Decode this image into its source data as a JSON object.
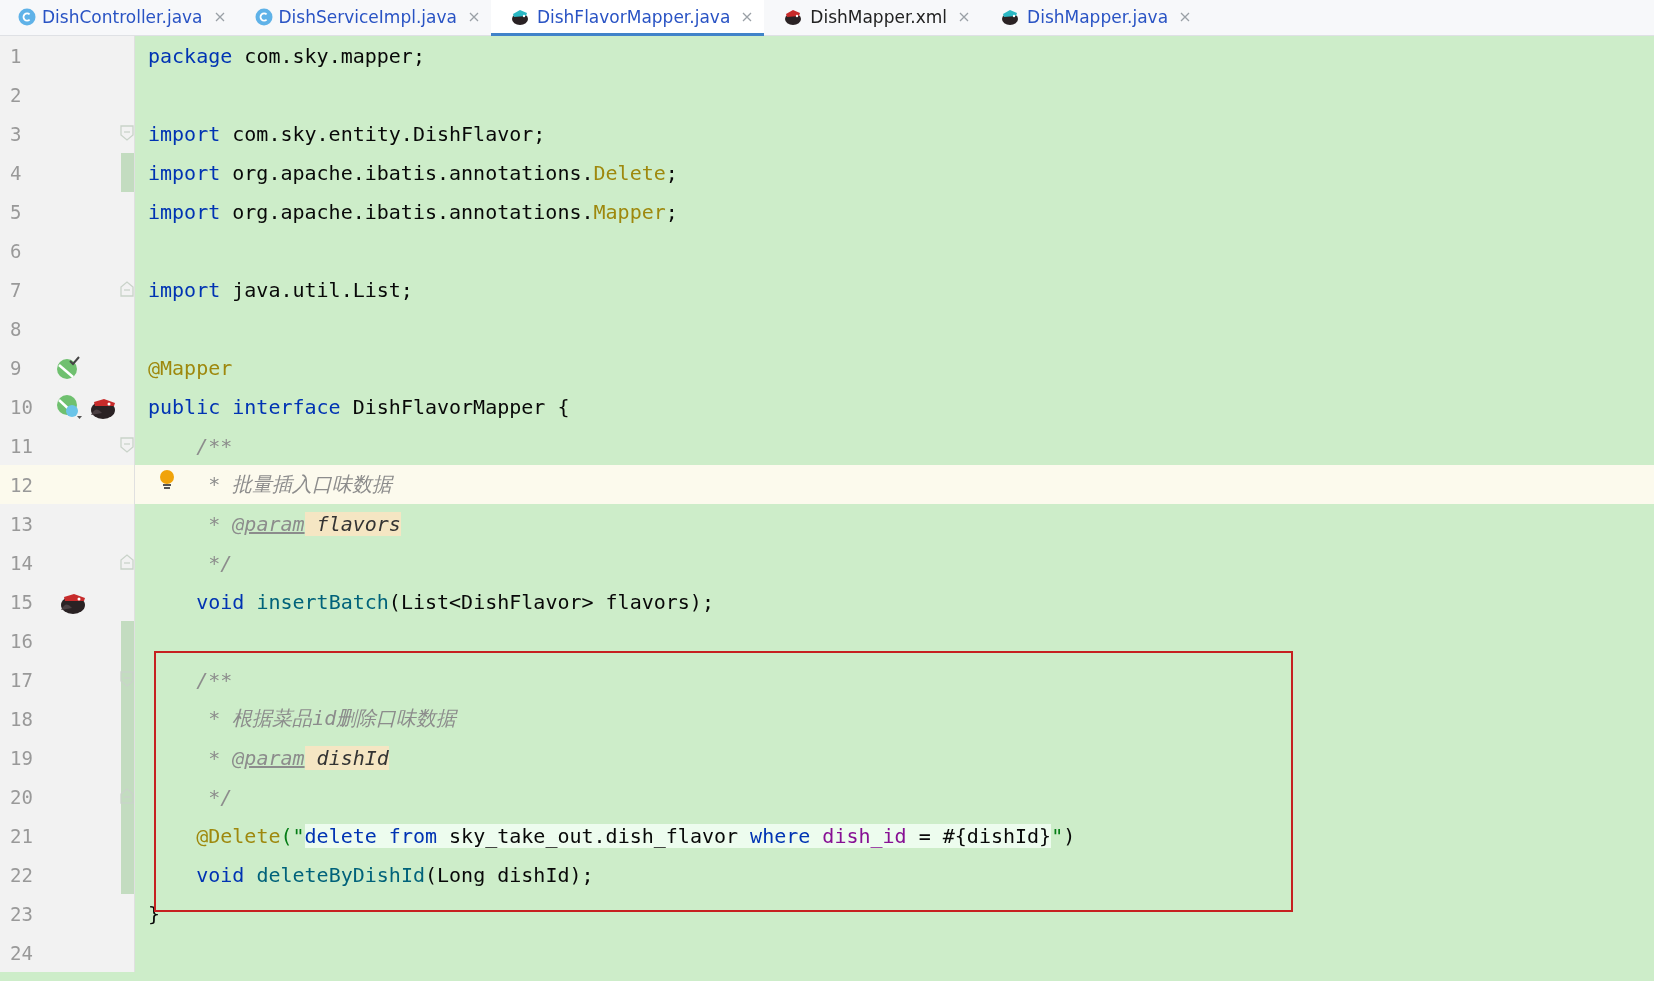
{
  "tabs": [
    {
      "label": "DishController.java",
      "kind": "class",
      "selected": false
    },
    {
      "label": "DishServiceImpl.java",
      "kind": "class",
      "selected": false
    },
    {
      "label": "DishFlavorMapper.java",
      "kind": "mapper",
      "selected": true
    },
    {
      "label": "DishMapper.xml",
      "kind": "xml",
      "selected": false
    },
    {
      "label": "DishMapper.java",
      "kind": "mapper",
      "selected": false
    }
  ],
  "editor": {
    "lines": [
      {
        "number": "1",
        "tokens": [
          {
            "text": "package",
            "kind": "kw"
          },
          {
            "text": " com.sky.mapper;",
            "kind": "plain"
          }
        ]
      },
      {
        "number": "2"
      },
      {
        "number": "3",
        "fold_start": true,
        "tokens": [
          {
            "text": "import",
            "kind": "kw"
          },
          {
            "text": " com.sky.entity.DishFlavor;",
            "kind": "plain"
          }
        ]
      },
      {
        "number": "4",
        "changed": true,
        "tokens": [
          {
            "text": "import",
            "kind": "kw"
          },
          {
            "text": " org.apache.ibatis.annotations.",
            "kind": "plain"
          },
          {
            "text": "Delete",
            "kind": "annotation"
          },
          {
            "text": ";",
            "kind": "plain"
          }
        ]
      },
      {
        "number": "5",
        "tokens": [
          {
            "text": "import",
            "kind": "kw"
          },
          {
            "text": " org.apache.ibatis.annotations.",
            "kind": "plain"
          },
          {
            "text": "Mapper",
            "kind": "annotation"
          },
          {
            "text": ";",
            "kind": "plain"
          }
        ]
      },
      {
        "number": "6"
      },
      {
        "number": "7",
        "fold_end": true,
        "tokens": [
          {
            "text": "import",
            "kind": "kw"
          },
          {
            "text": " java.util.List;",
            "kind": "plain"
          }
        ]
      },
      {
        "number": "8"
      },
      {
        "number": "9",
        "gutter_icons": [
          {
            "kind": "implemented"
          }
        ],
        "tokens": [
          {
            "text": "@Mapper",
            "kind": "annotation"
          }
        ]
      },
      {
        "number": "10",
        "gutter_icons": [
          {
            "kind": "implemented-class"
          },
          {
            "kind": "bird"
          }
        ],
        "tokens": [
          {
            "text": "public",
            "kind": "kw"
          },
          {
            "text": " interface",
            "kind": "kw"
          },
          {
            "text": " DishFlavorMapper {",
            "kind": "plain"
          }
        ]
      },
      {
        "number": "11",
        "fold_start": true,
        "tokens": [
          {
            "text": "    /**",
            "kind": "comment"
          }
        ]
      },
      {
        "number": "12",
        "current": true,
        "bulb": true,
        "tokens": [
          {
            "text": "     * 批量插入口味数据",
            "kind": "comment"
          }
        ]
      },
      {
        "number": "13",
        "tokens": [
          {
            "text": "     * ",
            "kind": "comment"
          },
          {
            "text": "@param",
            "kind": "doctag"
          },
          {
            "text": " flavors",
            "kind": "docparam"
          }
        ]
      },
      {
        "number": "14",
        "fold_end": true,
        "tokens": [
          {
            "text": "     */",
            "kind": "comment"
          }
        ]
      },
      {
        "number": "15",
        "gutter_icons": [
          {
            "kind": "bird"
          }
        ],
        "tokens": [
          {
            "text": "    void",
            "kind": "kw"
          },
          {
            "text": " insertBatch",
            "kind": "method"
          },
          {
            "text": "(List<DishFlavor> flavors);",
            "kind": "plain"
          }
        ]
      },
      {
        "number": "16",
        "changed": true
      },
      {
        "number": "17",
        "changed": true,
        "fold_start": true,
        "tokens": [
          {
            "text": "    /**",
            "kind": "comment"
          }
        ]
      },
      {
        "number": "18",
        "changed": true,
        "tokens": [
          {
            "text": "     * 根据菜品id删除口味数据",
            "kind": "comment"
          }
        ]
      },
      {
        "number": "19",
        "changed": true,
        "tokens": [
          {
            "text": "     * ",
            "kind": "comment"
          },
          {
            "text": "@param",
            "kind": "doctag"
          },
          {
            "text": " dishId",
            "kind": "docparam"
          }
        ]
      },
      {
        "number": "20",
        "changed": true,
        "fold_end": true,
        "tokens": [
          {
            "text": "     */",
            "kind": "comment"
          }
        ]
      },
      {
        "number": "21",
        "changed": true,
        "tokens": [
          {
            "text": "    @Delete",
            "kind": "annotation"
          },
          {
            "text": "(\"",
            "kind": "string"
          },
          {
            "text": "delete",
            "kind": "sql-kw"
          },
          {
            "text": " from",
            "kind": "sql-kw"
          },
          {
            "text": " sky_take_out.dish_flavor",
            "kind": "sql"
          },
          {
            "text": " where",
            "kind": "sql-kw"
          },
          {
            "text": " dish_id",
            "kind": "sql-col"
          },
          {
            "text": " = #{dishId}",
            "kind": "sql"
          },
          {
            "text": "\"",
            "kind": "string"
          },
          {
            "text": ")",
            "kind": "plain"
          }
        ]
      },
      {
        "number": "22",
        "changed": true,
        "tokens": [
          {
            "text": "    void",
            "kind": "kw"
          },
          {
            "text": " deleteByDishId",
            "kind": "method"
          },
          {
            "text": "(Long dishId);",
            "kind": "plain"
          }
        ]
      },
      {
        "number": "23",
        "tokens": [
          {
            "text": "}",
            "kind": "plain"
          }
        ]
      },
      {
        "number": "24"
      }
    ]
  },
  "highlight_frame": true
}
